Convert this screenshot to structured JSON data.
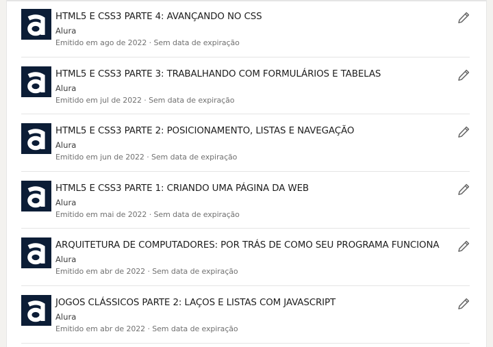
{
  "certifications": [
    {
      "title": "HTML5 E CSS3 PARTE 4: AVANÇANDO NO CSS",
      "issuer": "Alura",
      "meta": "Emitido em ago de 2022 · Sem data de expiração",
      "logo_icon": "alura-logo-icon",
      "edit_icon": "pencil-icon"
    },
    {
      "title": "HTML5 E CSS3 PARTE 3: TRABALHANDO COM FORMULÁRIOS E TABELAS",
      "issuer": "Alura",
      "meta": "Emitido em jul de 2022 · Sem data de expiração",
      "logo_icon": "alura-logo-icon",
      "edit_icon": "pencil-icon"
    },
    {
      "title": "HTML5 E CSS3 PARTE 2: POSICIONAMENTO, LISTAS E NAVEGAÇÃO",
      "issuer": "Alura",
      "meta": "Emitido em jun de 2022 · Sem data de expiração",
      "logo_icon": "alura-logo-icon",
      "edit_icon": "pencil-icon"
    },
    {
      "title": "HTML5 E CSS3 PARTE 1: CRIANDO UMA PÁGINA DA WEB",
      "issuer": "Alura",
      "meta": "Emitido em mai de 2022 · Sem data de expiração",
      "logo_icon": "alura-logo-icon",
      "edit_icon": "pencil-icon"
    },
    {
      "title": "ARQUITETURA DE COMPUTADORES: POR TRÁS DE COMO SEU PROGRAMA FUNCIONA",
      "issuer": "Alura",
      "meta": "Emitido em abr de 2022 · Sem data de expiração",
      "logo_icon": "alura-logo-icon",
      "edit_icon": "pencil-icon"
    },
    {
      "title": "JOGOS CLÁSSICOS PARTE 2: LAÇOS E LISTAS COM JAVASCRIPT",
      "issuer": "Alura",
      "meta": "Emitido em abr de 2022 · Sem data de expiração",
      "logo_icon": "alura-logo-icon",
      "edit_icon": "pencil-icon"
    }
  ],
  "colors": {
    "logo_background": "#0c1d36",
    "logo_glyph": "#ffffff",
    "title": "#1d1d1d",
    "meta": "#707070",
    "icon": "#666666"
  }
}
